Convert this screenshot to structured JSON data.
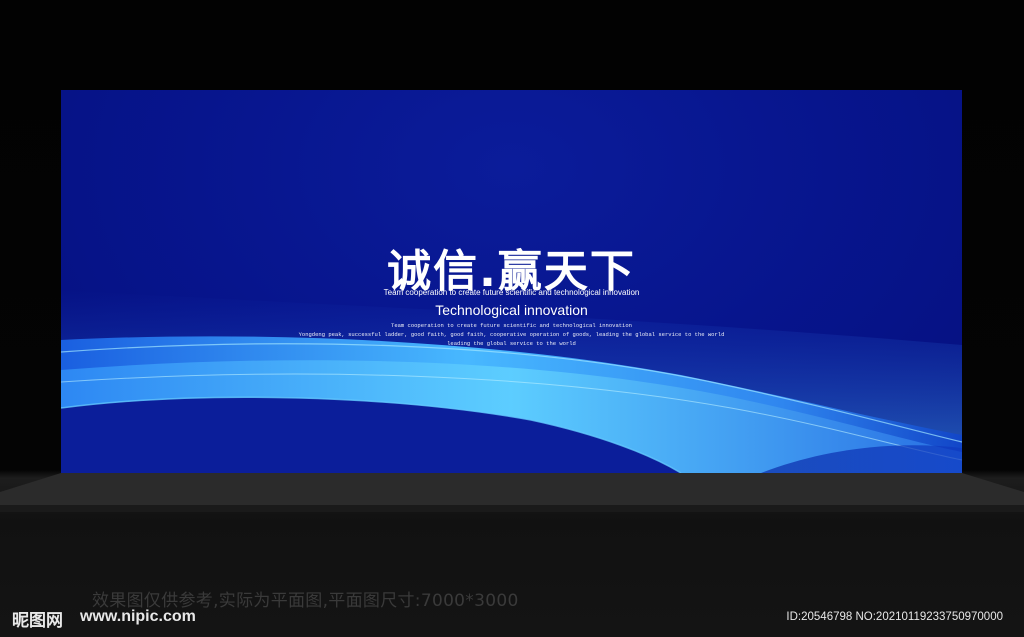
{
  "banner": {
    "title": "诚信.赢天下",
    "subtitle_small": "Team cooperation to create future scientific and technological innovation",
    "subtitle_large": "Technological innovation",
    "line_1": "Team cooperation to create future scientific and technological innovation",
    "line_2": "Yongdeng peak, successful ladder, good faith, good faith, cooperative operation of goods, leading the global service to the world",
    "line_3": "leading the global service to the world"
  },
  "watermark": {
    "caption": "效果图仅供参考,实际为平面图,平面图尺寸:7000*3000",
    "logo_text": "昵图网",
    "url": "www.nipic.com",
    "id_text": "ID:20546798 NO:20210119233750970000"
  },
  "colors": {
    "banner_base": "#07158d",
    "wave_light": "#4fc3ff",
    "wave_dark": "#0a2aa8"
  }
}
